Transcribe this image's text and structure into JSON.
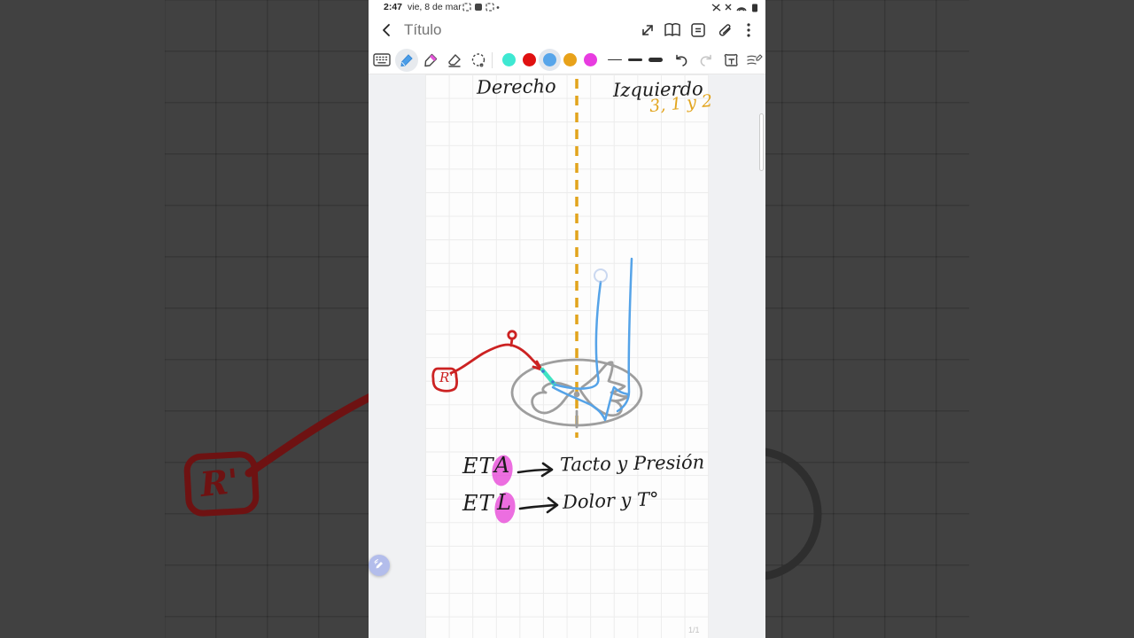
{
  "status_bar": {
    "time": "2:47",
    "date": "vie, 8 de mar"
  },
  "title_bar": {
    "title": "Título"
  },
  "toolbar": {
    "pen_colors": [
      "#3EE8D2",
      "#E01111",
      "#57A5EA",
      "#E8A21A",
      "#E83CE0"
    ],
    "selected_color": "#57A5EA",
    "selected_tool": "pen"
  },
  "canvas": {
    "heading_right": "Derecho",
    "heading_left": "Izquierdo",
    "heading_numbers": "3, 1 y 2",
    "receptor_label": "R'",
    "legend": [
      {
        "prefix": "ET",
        "letter": "A",
        "text": "Tacto y Presión"
      },
      {
        "prefix": "ET",
        "letter": "L",
        "text": "Dolor y T°"
      }
    ],
    "page_indicator": "1/1"
  },
  "background": {
    "receptor_label": "R'"
  },
  "colors": {
    "divider_dash": "#E2A41C",
    "red_pen": "#CC2222",
    "cyan_pen": "#3FE3C3",
    "blue_pen": "#55A3E8",
    "gray_pen": "#9E9E9E",
    "highlighter": "#E847D8",
    "float_button": "#B3BDEB",
    "bg_red": "#6E1212"
  }
}
